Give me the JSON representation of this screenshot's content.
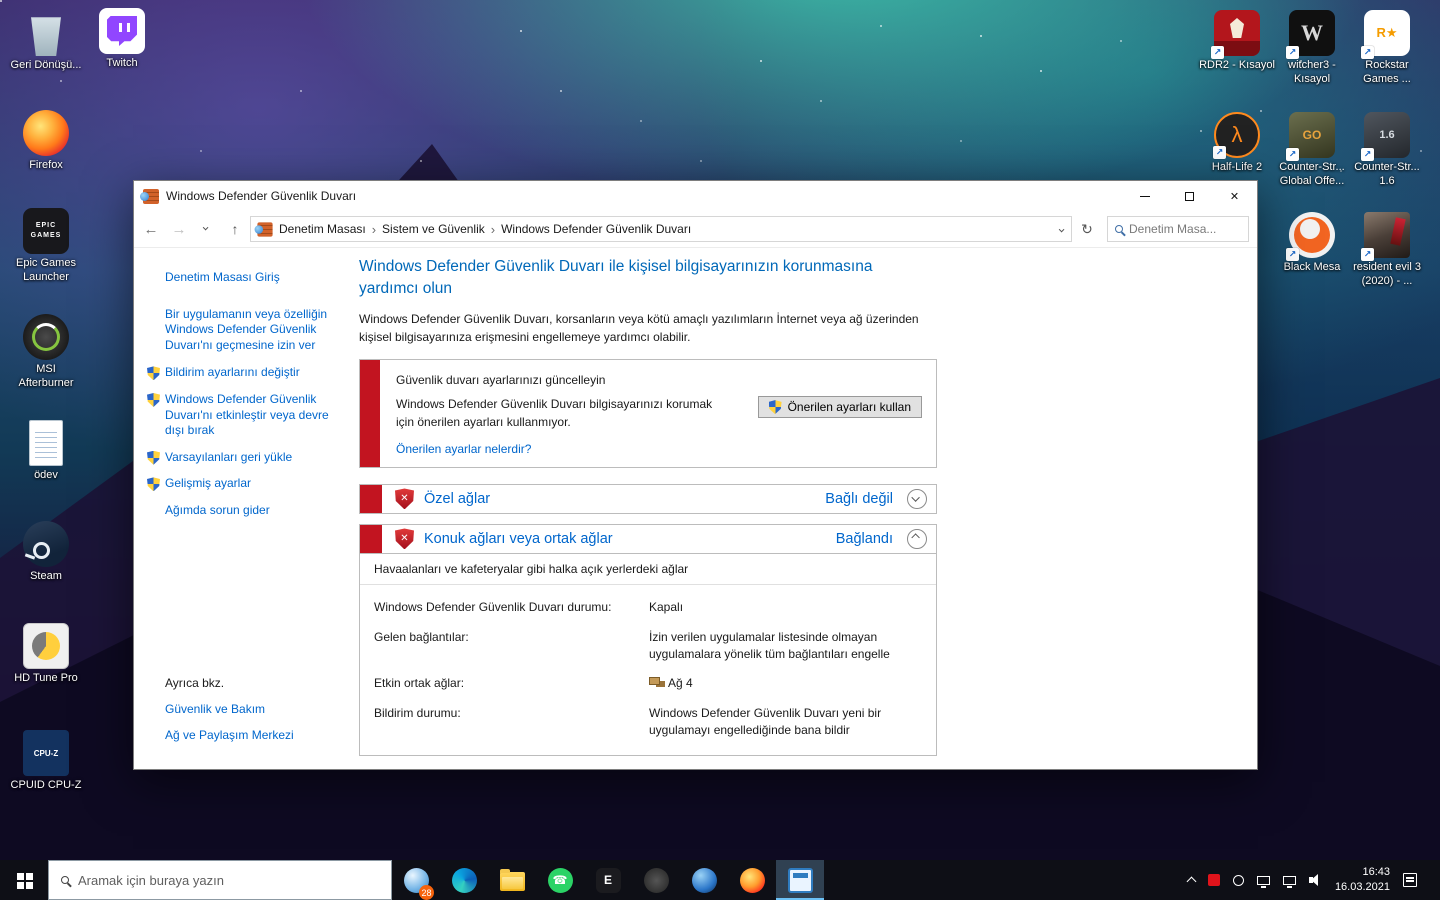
{
  "desktop": {
    "icons_left": [
      {
        "label": "Geri Dönüşü..."
      },
      {
        "label": "Twitch"
      },
      {
        "label": "Firefox"
      },
      {
        "label": "Epic Games Launcher"
      },
      {
        "label": "MSI Afterburner"
      },
      {
        "label": "ödev"
      },
      {
        "label": "Steam"
      },
      {
        "label": "HD Tune Pro"
      },
      {
        "label": "CPUID CPU-Z"
      }
    ],
    "icons_right": [
      {
        "label": "RDR2 - Kısayol"
      },
      {
        "label": "witcher3 - Kısayol"
      },
      {
        "label": "Rockstar Games ..."
      },
      {
        "label": "Half-Life 2"
      },
      {
        "label": "Counter-Str... Global Offe..."
      },
      {
        "label": "Counter-Str... 1.6"
      },
      {
        "label": "Black Mesa"
      },
      {
        "label": "resident evil 3 (2020) - ..."
      }
    ]
  },
  "window": {
    "title": "Windows Defender Güvenlik Duvarı",
    "nav": {
      "breadcrumb": [
        "Denetim Masası",
        "Sistem ve Güvenlik",
        "Windows Defender Güvenlik Duvarı"
      ],
      "search_placeholder": "Denetim Masa..."
    },
    "sidebar": {
      "items": [
        {
          "label": "Denetim Masası Giriş",
          "shield": false
        },
        {
          "label": "Bir uygulamanın veya özelliğin Windows Defender Güvenlik Duvarı'nı geçmesine izin ver",
          "shield": false
        },
        {
          "label": "Bildirim ayarlarını değiştir",
          "shield": true
        },
        {
          "label": "Windows Defender Güvenlik Duvarı'nı etkinleştir veya devre dışı bırak",
          "shield": true
        },
        {
          "label": "Varsayılanları geri yükle",
          "shield": true
        },
        {
          "label": "Gelişmiş ayarlar",
          "shield": true
        },
        {
          "label": "Ağımda sorun gider",
          "shield": false
        }
      ],
      "see_also": {
        "title": "Ayrıca bkz.",
        "items": [
          "Güvenlik ve Bakım",
          "Ağ ve Paylaşım Merkezi"
        ]
      }
    },
    "main": {
      "title": "Windows Defender Güvenlik Duvarı ile kişisel bilgisayarınızın korunmasına yardımcı olun",
      "description": "Windows Defender Güvenlik Duvarı, korsanların veya kötü amaçlı yazılımların İnternet veya ağ üzerinden kişisel bilgisayarınıza erişmesini engellemeye yardımcı olabilir.",
      "alert": {
        "title": "Güvenlik duvarı ayarlarınızı güncelleyin",
        "body": "Windows Defender Güvenlik Duvarı bilgisayarınızı korumak için önerilen ayarları kullanmıyor.",
        "button_label": "Önerilen ayarları kullan",
        "link": "Önerilen ayarlar nelerdir?"
      },
      "sections": [
        {
          "title": "Özel ağlar",
          "status": "Bağlı değil",
          "expanded": false
        },
        {
          "title": "Konuk ağları veya ortak ağlar",
          "status": "Bağlandı",
          "expanded": true
        }
      ],
      "panel": {
        "subtitle": "Havaalanları ve kafeteryalar gibi halka açık yerlerdeki ağlar",
        "details": [
          {
            "label": "Windows Defender Güvenlik Duvarı durumu:",
            "value": "Kapalı"
          },
          {
            "label": "Gelen bağlantılar:",
            "value": "İzin verilen uygulamalar listesinde olmayan uygulamalara yönelik tüm bağlantıları engelle"
          },
          {
            "label": "Etkin ortak ağlar:",
            "value": "Ağ 4"
          },
          {
            "label": "Bildirim durumu:",
            "value": "Windows Defender Güvenlik Duvarı yeni bir uygulamayı engellediğinde bana bildir"
          }
        ]
      }
    }
  },
  "taskbar": {
    "search_placeholder": "Aramak için buraya yazın",
    "news_badge": "28",
    "clock": {
      "time": "16:43",
      "date": "16.03.2021"
    }
  },
  "colors": {
    "link_blue": "#0066cc",
    "heading_blue": "#0068b8",
    "alert_red": "#c21420",
    "taskbar_accent": "#6cc1f5"
  }
}
